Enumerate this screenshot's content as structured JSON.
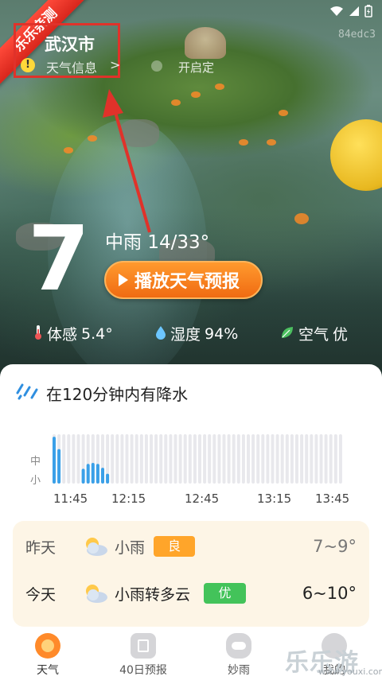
{
  "ribbon": "乐乐亲测",
  "device_code": "84edc3",
  "location": {
    "city": "武汉市",
    "info_label": "天气信息",
    "chevron": ">",
    "open_label": "开启定"
  },
  "current": {
    "temp": "7",
    "degree": "°",
    "condition": "中雨",
    "range": "14/33°",
    "play_label": "播放天气预报",
    "feels_label": "体感",
    "feels_value": "5.4°",
    "humidity_label": "湿度",
    "humidity_value": "94%",
    "air_label": "空气",
    "air_value": "优"
  },
  "precip": {
    "title": "在120分钟内有降水",
    "y_labels": [
      "中",
      "小"
    ],
    "x_labels": [
      "11:45",
      "12:15",
      "12:45",
      "13:15",
      "13:45"
    ]
  },
  "chart_data": {
    "type": "bar",
    "intensity_levels": [
      "中",
      "小"
    ],
    "x_ticks": [
      "11:45",
      "12:15",
      "12:45",
      "13:15",
      "13:45"
    ],
    "values": [
      0.95,
      0.7,
      0,
      0,
      0,
      0,
      0.3,
      0.4,
      0.42,
      0.4,
      0.32,
      0.2,
      0,
      0,
      0,
      0,
      0,
      0,
      0,
      0,
      0,
      0,
      0,
      0,
      0,
      0,
      0,
      0,
      0,
      0,
      0,
      0,
      0,
      0,
      0,
      0,
      0,
      0,
      0,
      0,
      0,
      0,
      0,
      0,
      0,
      0,
      0,
      0,
      0,
      0,
      0,
      0,
      0,
      0,
      0,
      0,
      0,
      0,
      0,
      0
    ],
    "colors": {
      "active": "#3aa0e8",
      "inactive": "#e8e8ec"
    }
  },
  "forecast": [
    {
      "day": "昨天",
      "condition": "小雨",
      "aqi": "良",
      "aqi_color": "#ffa52a",
      "range": "7~9°"
    },
    {
      "day": "今天",
      "condition": "小雨转多云",
      "aqi": "优",
      "aqi_color": "#43c35a",
      "range": "6~10°"
    }
  ],
  "nav": [
    {
      "label": "天气",
      "active": true
    },
    {
      "label": "40日预报",
      "active": false
    },
    {
      "label": "妙雨",
      "active": false
    },
    {
      "label": "我的",
      "active": false
    }
  ],
  "watermark": {
    "main": "乐乐游戏",
    "sub": "www.youxi.com"
  },
  "colors": {
    "accent": "#f06b12",
    "ribbon": "#d8261c",
    "highlight_box": "#e0322a",
    "precip_bar": "#3aa0e8"
  }
}
